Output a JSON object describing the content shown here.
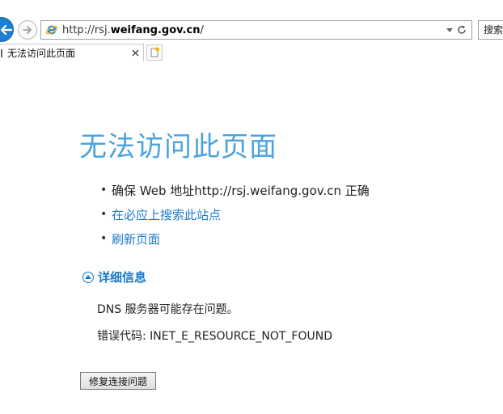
{
  "browser": {
    "address": {
      "url_prefix": "http://rsj.",
      "url_domain": "weifang.gov.cn",
      "url_suffix": "/"
    },
    "search_label": "搜索",
    "tab": {
      "title": "无法访问此页面"
    }
  },
  "page": {
    "title": "无法访问此页面",
    "bullets": [
      {
        "text": "确保 Web 地址http://rsj.weifang.gov.cn 正确"
      },
      {
        "text": "在必应上搜索此站点"
      },
      {
        "text": "刷新页面"
      }
    ],
    "details": {
      "label": "详细信息",
      "dns_message": "DNS 服务器可能存在问题。",
      "error_code": "错误代码: INET_E_RESOURCE_NOT_FOUND"
    },
    "fix_button_label": "修复连接问题"
  },
  "colors": {
    "title": "#4aa3df",
    "link": "#1a79c9",
    "back_button": "#1e7fd1"
  },
  "icons": {
    "back": "back-arrow-icon",
    "forward": "forward-arrow-icon",
    "site": "ie-logo-icon",
    "dropdown": "chevron-down-icon",
    "refresh": "refresh-icon",
    "close_tab": "close-icon",
    "new_tab": "new-tab-icon",
    "details": "chevron-up-circle-icon"
  }
}
